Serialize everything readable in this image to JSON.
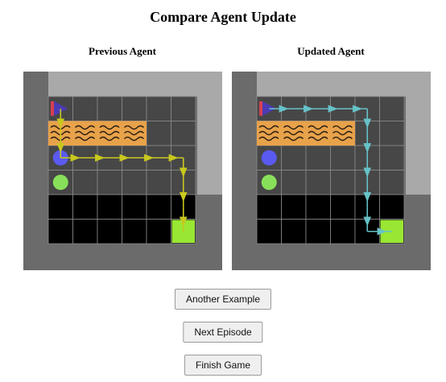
{
  "title": "Compare Agent Update",
  "panels": {
    "left": {
      "label": "Previous Agent",
      "arrow_color": "#c8c81e"
    },
    "right": {
      "label": "Updated Agent",
      "arrow_color": "#66c2c8"
    }
  },
  "buttons": {
    "another_example": "Another Example",
    "next_episode": "Next Episode",
    "finish_game": "Finish Game"
  },
  "colors": {
    "wall": "#6b6b6b",
    "floor_light": "#a9a9a9",
    "grid_cell": "#474747",
    "lava": "#e8a24a",
    "pit": "#000000",
    "goal": "#99e633",
    "key": "#5a5af0",
    "ball": "#88e05a",
    "agent": "#4b3bb5",
    "flag": "#d64050"
  }
}
